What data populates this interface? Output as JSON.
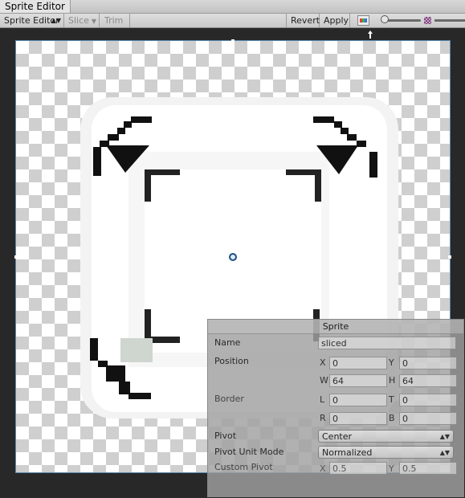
{
  "window": {
    "tab_title": "Sprite Editor"
  },
  "toolbar": {
    "mode_label": "Sprite Editor",
    "slice_label": "Slice",
    "trim_label": "Trim",
    "revert_label": "Revert",
    "apply_label": "Apply",
    "zoom_level": 0.1
  },
  "colors": {
    "selection_outline": "#5a8ab0",
    "pivot": "#1a4e86"
  },
  "sprite_panel": {
    "title": "Sprite",
    "name_label": "Name",
    "name_value": "sliced",
    "position_label": "Position",
    "x_axis": "X",
    "y_axis": "Y",
    "w_axis": "W",
    "h_axis": "H",
    "l_axis": "L",
    "t_axis": "T",
    "r_axis": "R",
    "b_axis": "B",
    "pos_x": "0",
    "pos_y": "0",
    "width": "64",
    "height": "64",
    "border_label": "Border",
    "border_l": "0",
    "border_t": "0",
    "border_r": "0",
    "border_b": "0",
    "pivot_label": "Pivot",
    "pivot_value": "Center",
    "pivot_unit_label": "Pivot Unit Mode",
    "pivot_unit_value": "Normalized",
    "custom_pivot_label": "Custom Pivot",
    "custom_x": "0.5",
    "custom_y": "0.5"
  }
}
